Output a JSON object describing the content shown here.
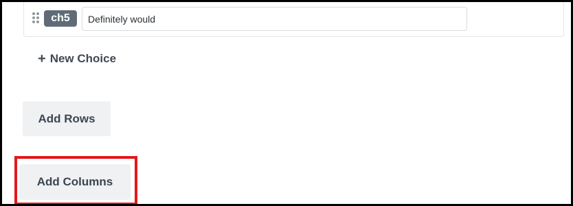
{
  "choice_row": {
    "tag": "ch5",
    "value": "Definitely would"
  },
  "new_choice": {
    "icon": "plus-icon",
    "icon_glyph": "+",
    "label": "New Choice"
  },
  "buttons": {
    "add_rows": "Add Rows",
    "add_columns": "Add Columns"
  },
  "colors": {
    "tag_background": "#5f6c78",
    "button_background": "#eff1f3",
    "highlight_border": "#e3171b",
    "frame_border": "#000000"
  }
}
